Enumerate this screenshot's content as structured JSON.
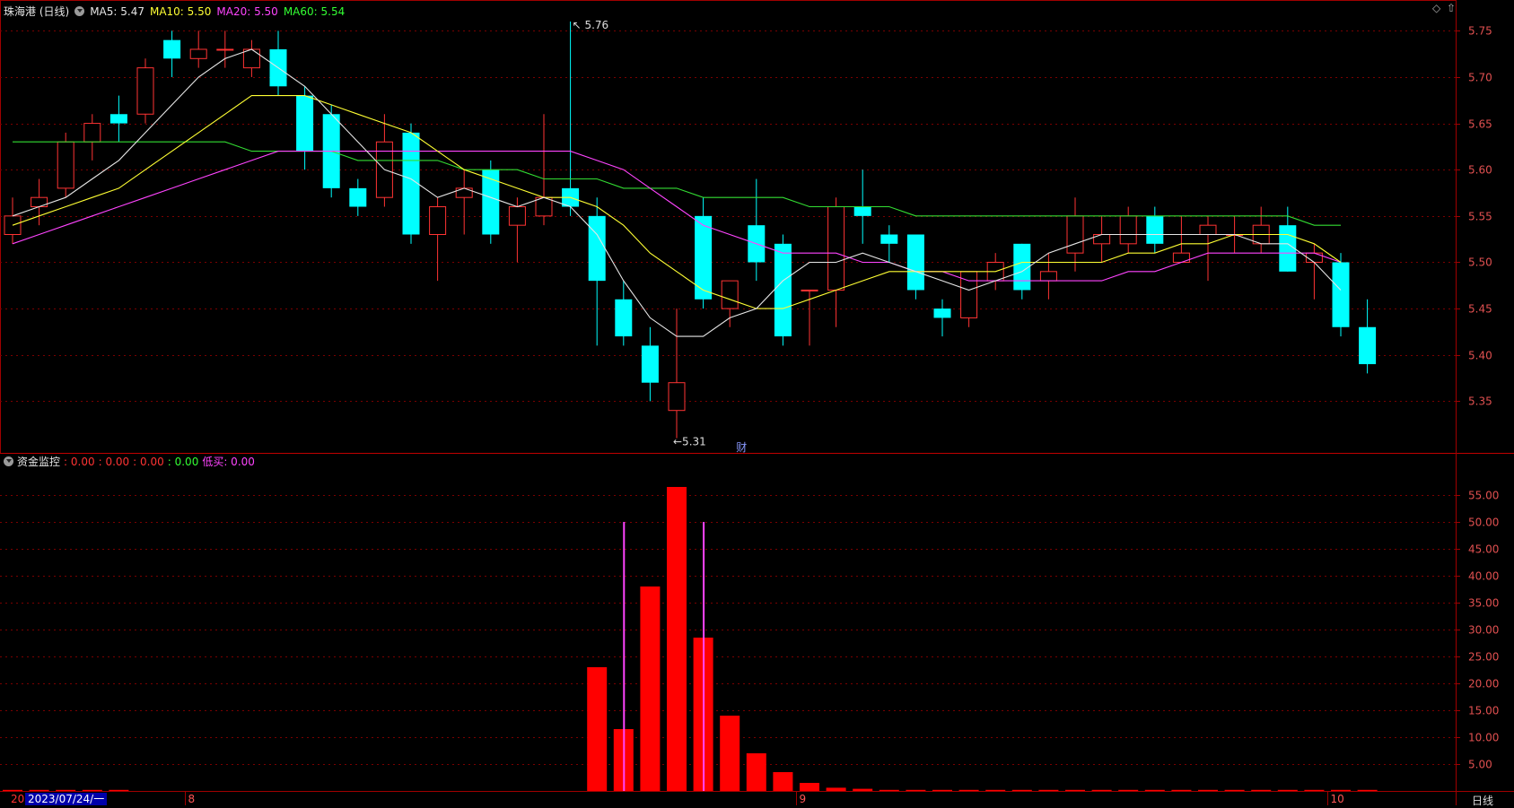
{
  "header": {
    "title": "珠海港 (日线)",
    "ma5": "MA5: 5.47",
    "ma10": "MA10: 5.50",
    "ma20": "MA20: 5.50",
    "ma60": "MA60: 5.54"
  },
  "sub_header": {
    "title": "资金监控",
    "v1": ": 0.00",
    "v2": ": 0.00",
    "v3": ": 0.00",
    "v4": ": 0.00",
    "low_buy": "低买: 0.00"
  },
  "footer": {
    "start_label": "20",
    "date_label": "2023/07/24/一",
    "period": "日线"
  },
  "controls": {
    "diamond": "◇",
    "up": "⇧"
  },
  "colors": {
    "up": "#ff3333",
    "down": "#00ffff",
    "ma5": "#e6e6e6",
    "ma10": "#ffff33",
    "ma20": "#ff44ff",
    "ma60": "#33dd33",
    "grid": "#7a0000",
    "volume": "#ff0000",
    "signal": "#ff44ff"
  },
  "chart_data": [
    {
      "type": "candlestick",
      "title": "珠海港 (日线)",
      "ylim": [
        5.3,
        5.76
      ],
      "y_ticks": [
        "5.75",
        "5.70",
        "5.65",
        "5.60",
        "5.55",
        "5.50",
        "5.45",
        "5.40",
        "5.35"
      ],
      "x_markers": [
        "8",
        "9",
        "10"
      ],
      "x_marker_index": [
        7,
        30,
        50
      ],
      "annotations": {
        "high": "5.76",
        "low": "5.31",
        "event": "财"
      },
      "candles": [
        [
          5.53,
          5.55,
          5.57,
          5.52
        ],
        [
          5.56,
          5.57,
          5.59,
          5.54
        ],
        [
          5.58,
          5.63,
          5.64,
          5.57
        ],
        [
          5.63,
          5.65,
          5.66,
          5.61
        ],
        [
          5.66,
          5.65,
          5.68,
          5.63
        ],
        [
          5.66,
          5.71,
          5.72,
          5.65
        ],
        [
          5.74,
          5.72,
          5.75,
          5.7
        ],
        [
          5.72,
          5.73,
          5.75,
          5.71
        ],
        [
          5.73,
          5.73,
          5.75,
          5.71
        ],
        [
          5.71,
          5.73,
          5.74,
          5.7
        ],
        [
          5.73,
          5.69,
          5.75,
          5.68
        ],
        [
          5.68,
          5.62,
          5.69,
          5.6
        ],
        [
          5.66,
          5.58,
          5.67,
          5.57
        ],
        [
          5.58,
          5.56,
          5.59,
          5.55
        ],
        [
          5.57,
          5.63,
          5.66,
          5.56
        ],
        [
          5.64,
          5.53,
          5.65,
          5.52
        ],
        [
          5.53,
          5.56,
          5.57,
          5.48
        ],
        [
          5.57,
          5.58,
          5.6,
          5.53
        ],
        [
          5.6,
          5.53,
          5.61,
          5.52
        ],
        [
          5.54,
          5.56,
          5.57,
          5.5
        ],
        [
          5.55,
          5.57,
          5.66,
          5.54
        ],
        [
          5.58,
          5.56,
          5.76,
          5.55
        ],
        [
          5.55,
          5.48,
          5.57,
          5.41
        ],
        [
          5.46,
          5.42,
          5.48,
          5.41
        ],
        [
          5.41,
          5.37,
          5.43,
          5.35
        ],
        [
          5.34,
          5.37,
          5.45,
          5.31
        ],
        [
          5.55,
          5.46,
          5.57,
          5.45
        ],
        [
          5.45,
          5.48,
          5.48,
          5.43
        ],
        [
          5.54,
          5.5,
          5.59,
          5.48
        ],
        [
          5.52,
          5.42,
          5.53,
          5.41
        ],
        [
          5.47,
          5.47,
          5.47,
          5.41
        ],
        [
          5.47,
          5.56,
          5.57,
          5.43
        ],
        [
          5.56,
          5.55,
          5.6,
          5.52
        ],
        [
          5.53,
          5.52,
          5.54,
          5.5
        ],
        [
          5.53,
          5.47,
          5.53,
          5.46
        ],
        [
          5.45,
          5.44,
          5.46,
          5.42
        ],
        [
          5.44,
          5.49,
          5.49,
          5.43
        ],
        [
          5.48,
          5.5,
          5.51,
          5.47
        ],
        [
          5.52,
          5.47,
          5.52,
          5.46
        ],
        [
          5.48,
          5.49,
          5.51,
          5.46
        ],
        [
          5.51,
          5.55,
          5.57,
          5.49
        ],
        [
          5.52,
          5.53,
          5.55,
          5.5
        ],
        [
          5.52,
          5.55,
          5.56,
          5.51
        ],
        [
          5.55,
          5.52,
          5.56,
          5.51
        ],
        [
          5.5,
          5.51,
          5.55,
          5.5
        ],
        [
          5.53,
          5.54,
          5.55,
          5.48
        ],
        [
          5.53,
          5.53,
          5.55,
          5.51
        ],
        [
          5.52,
          5.54,
          5.56,
          5.51
        ],
        [
          5.54,
          5.49,
          5.56,
          5.49
        ],
        [
          5.5,
          5.51,
          5.52,
          5.46
        ],
        [
          5.5,
          5.43,
          5.51,
          5.42
        ],
        [
          5.43,
          5.39,
          5.46,
          5.38
        ]
      ],
      "ma5": [
        5.55,
        5.56,
        5.57,
        5.59,
        5.61,
        5.64,
        5.67,
        5.7,
        5.72,
        5.73,
        5.71,
        5.69,
        5.66,
        5.63,
        5.6,
        5.59,
        5.57,
        5.58,
        5.57,
        5.56,
        5.57,
        5.56,
        5.53,
        5.48,
        5.44,
        5.42,
        5.42,
        5.44,
        5.45,
        5.48,
        5.5,
        5.5,
        5.51,
        5.5,
        5.49,
        5.48,
        5.47,
        5.48,
        5.49,
        5.51,
        5.52,
        5.53,
        5.53,
        5.53,
        5.53,
        5.53,
        5.53,
        5.52,
        5.52,
        5.5,
        5.47
      ],
      "ma10": [
        5.54,
        5.55,
        5.56,
        5.57,
        5.58,
        5.6,
        5.62,
        5.64,
        5.66,
        5.68,
        5.68,
        5.68,
        5.67,
        5.66,
        5.65,
        5.64,
        5.62,
        5.6,
        5.59,
        5.58,
        5.57,
        5.57,
        5.56,
        5.54,
        5.51,
        5.49,
        5.47,
        5.46,
        5.45,
        5.45,
        5.46,
        5.47,
        5.48,
        5.49,
        5.49,
        5.49,
        5.49,
        5.49,
        5.5,
        5.5,
        5.5,
        5.5,
        5.51,
        5.51,
        5.52,
        5.52,
        5.53,
        5.53,
        5.53,
        5.52,
        5.5
      ],
      "ma20": [
        5.52,
        5.53,
        5.54,
        5.55,
        5.56,
        5.57,
        5.58,
        5.59,
        5.6,
        5.61,
        5.62,
        5.62,
        5.62,
        5.62,
        5.62,
        5.62,
        5.62,
        5.62,
        5.62,
        5.62,
        5.62,
        5.62,
        5.61,
        5.6,
        5.58,
        5.56,
        5.54,
        5.53,
        5.52,
        5.51,
        5.51,
        5.51,
        5.5,
        5.5,
        5.49,
        5.49,
        5.48,
        5.48,
        5.48,
        5.48,
        5.48,
        5.48,
        5.49,
        5.49,
        5.5,
        5.51,
        5.51,
        5.51,
        5.51,
        5.51,
        5.5
      ],
      "ma60": [
        5.63,
        5.63,
        5.63,
        5.63,
        5.63,
        5.63,
        5.63,
        5.63,
        5.63,
        5.62,
        5.62,
        5.62,
        5.62,
        5.61,
        5.61,
        5.61,
        5.61,
        5.6,
        5.6,
        5.6,
        5.59,
        5.59,
        5.59,
        5.58,
        5.58,
        5.58,
        5.57,
        5.57,
        5.57,
        5.57,
        5.56,
        5.56,
        5.56,
        5.56,
        5.55,
        5.55,
        5.55,
        5.55,
        5.55,
        5.55,
        5.55,
        5.55,
        5.55,
        5.55,
        5.55,
        5.55,
        5.55,
        5.55,
        5.55,
        5.54,
        5.54
      ]
    },
    {
      "type": "bar",
      "title": "资金监控",
      "ylim": [
        0,
        60
      ],
      "y_ticks": [
        "55.00",
        "50.00",
        "45.00",
        "40.00",
        "35.00",
        "30.00",
        "25.00",
        "20.00",
        "15.00",
        "10.00",
        "5.00"
      ],
      "values": [
        0.2,
        0.2,
        0.2,
        0.2,
        0.2,
        0,
        0,
        0,
        0,
        0,
        0,
        0,
        0,
        0,
        0,
        0,
        0,
        0,
        0,
        0,
        0,
        0,
        23.0,
        11.5,
        38.0,
        56.5,
        28.5,
        14.0,
        7.0,
        3.5,
        1.5,
        0.6,
        0.4,
        0.2,
        0.2,
        0.2,
        0.2,
        0.2,
        0.2,
        0.2,
        0.2,
        0.2,
        0.2,
        0.2,
        0.2,
        0.2,
        0.2,
        0.2,
        0.2,
        0.2,
        0.2,
        0.2
      ],
      "signal_index": [
        23,
        26
      ],
      "signal_value": 50
    }
  ]
}
